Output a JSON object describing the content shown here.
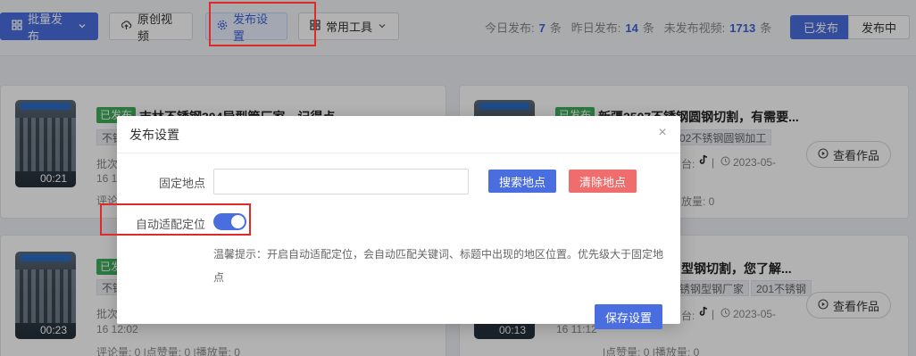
{
  "toolbar": {
    "batch_publish": "批量发布",
    "original_video": "原创视频",
    "publish_settings": "发布设置",
    "common_tools": "常用工具"
  },
  "stats": {
    "today_label": "今日发布:",
    "today_value": "7",
    "today_unit": "条",
    "yesterday_label": "昨日发布:",
    "yesterday_value": "14",
    "yesterday_unit": "条",
    "unpublished_label": "未发布视频:",
    "unpublished_value": "1713",
    "unpublished_unit": "条"
  },
  "status_tabs": {
    "published": "已发布",
    "publishing": "发布中"
  },
  "cards": {
    "c1": {
      "badge": "已发布",
      "title": "吉林不锈钢304异型管厂家，记得点",
      "keyword": "不锈",
      "meta1": "批次",
      "meta2": "16 18",
      "meta3": "评论",
      "duration": "00:21"
    },
    "c2": {
      "badge": "已发布",
      "title": "新疆2507不锈钢圆钢切割，有需要...",
      "keyword": "02不锈钢圆钢加工",
      "platform": "台:",
      "date": "2023-05-",
      "plays": "放量: 0",
      "view": "查看作品"
    },
    "c3": {
      "badge": "已发",
      "keyword": "不锈",
      "meta1": "批次",
      "meta2": "16 12:02",
      "stats": "评论量: 0  |点赞量: 0  |播放量: 0",
      "duration": "00:23"
    },
    "c4": {
      "title": "型钢切割，您了解...",
      "keyword1": "锈钢型钢厂家",
      "keyword2": "201不锈钢",
      "platform": "台:",
      "date": "2023-05-",
      "meta2": "16 11:12",
      "stats": "|点赞量: 0  |播放量: 0",
      "duration": "00:13",
      "view": "查看作品"
    }
  },
  "modal": {
    "title": "发布设置",
    "fixed_location_label": "固定地点",
    "fixed_location_value": "",
    "search_location": "搜索地点",
    "clear_location": "清除地点",
    "auto_locate_label": "自动适配定位",
    "auto_locate_on": true,
    "hint": "温馨提示：开启自动适配定位，会自动匹配关键词、标题中出现的地区位置。优先级大于固定地点",
    "save": "保存设置"
  },
  "colors": {
    "accent": "#4a6ee0",
    "danger": "#ef6d6d",
    "published": "#3fae5c",
    "highlight": "#e02a2a"
  }
}
